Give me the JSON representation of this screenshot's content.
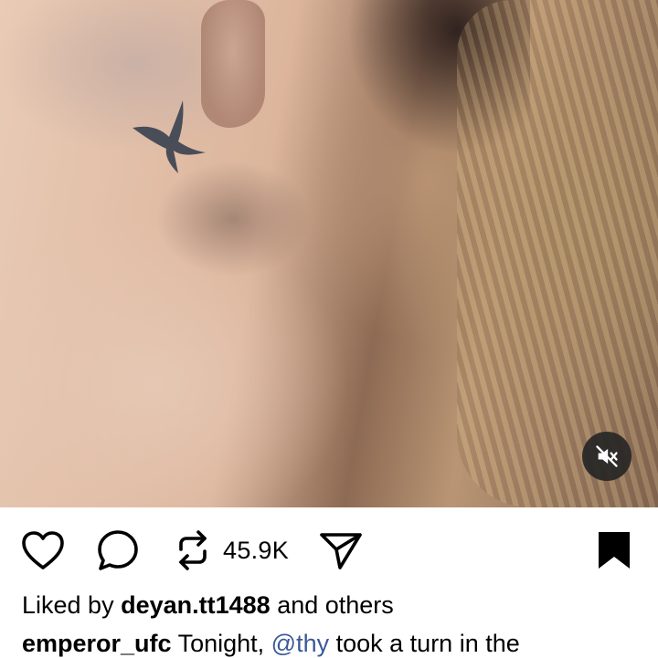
{
  "post": {
    "media": {
      "type": "video",
      "description_icon": "muted-speaker-icon"
    },
    "actions": {
      "like_icon": "heart-icon",
      "comment_icon": "comment-icon",
      "repost_icon": "repost-icon",
      "repost_count": "45.9K",
      "share_icon": "send-icon",
      "save_icon": "bookmark-icon"
    },
    "likes": {
      "prefix": "Liked by",
      "user": "deyan.tt1488",
      "suffix": "and others"
    },
    "caption": {
      "author": "emperor_ufc",
      "text_start": "Tonight,",
      "mention": "@thy",
      "text_end": "took a turn in the"
    }
  }
}
